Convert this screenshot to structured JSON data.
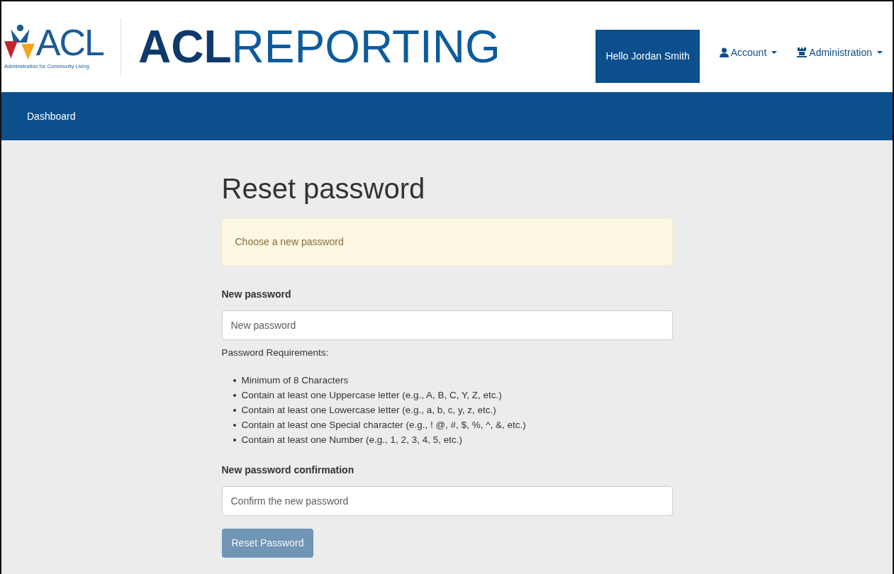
{
  "logo": {
    "name": "ACL",
    "tagline": "Administration for Community Living"
  },
  "site_title": "**ACL**REPORTING",
  "header_nav": [
    {
      "kind": "greeting",
      "label": "Hello Jordan Smith"
    },
    {
      "kind": "account",
      "label": "Account"
    },
    {
      "kind": "admin",
      "label": "Administration"
    }
  ],
  "main_nav": [
    {
      "label": "Dashboard"
    }
  ],
  "form": {
    "title": "Reset password",
    "alert": "Choose a new password",
    "fields": [
      {
        "label": "New password",
        "placeholder": "New password"
      }
    ],
    "requirements_title": "Password Requirements:",
    "requirements": [
      "Minimum of 8 Characters",
      "Contain at least one Uppercase letter (e.g., A, B, C, Y, Z, etc.)",
      "Contain at least one Lowercase letter (e.g., a, b, c, y, z, etc.)",
      "Contain at least one Special character (e.g., ! @, #, $, %, ^, &, etc.)",
      "Contain at least one Number (e.g., 1, 2, 3, 4, 5, etc.)"
    ],
    "confirm_field": {
      "label": "New password confirmation",
      "placeholder": "Confirm the new password"
    },
    "submit": {
      "label": "Reset Password",
      "disabled": true
    }
  }
}
